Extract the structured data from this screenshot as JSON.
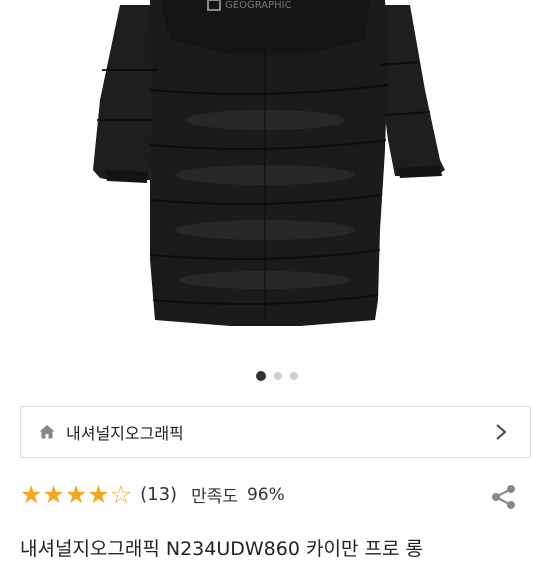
{
  "product_image": {
    "logo_text": "GEOGRAPHIC",
    "slide_count": 3,
    "active_slide": 1
  },
  "brand": {
    "name": "내셔널지오그래픽",
    "home_icon": "home-icon",
    "chevron_icon": "chevron-right-icon"
  },
  "rating": {
    "stars": 4.5,
    "review_count": "(13)",
    "satisfaction_label": "만족도",
    "satisfaction_value": "96%"
  },
  "product": {
    "title": "내셔널지오그래픽 N234UDW860 카이만 프로 롱"
  },
  "colors": {
    "star": "#f5a623",
    "jacket": "#1c1c1c",
    "active_dot": "#333333"
  }
}
